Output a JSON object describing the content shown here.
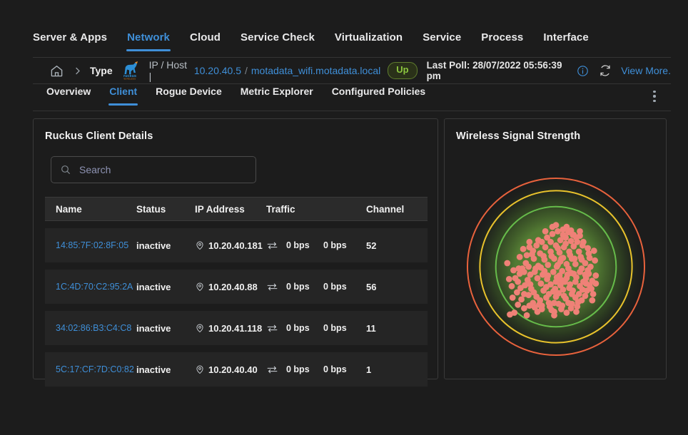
{
  "topnav": {
    "items": [
      {
        "label": "Server & Apps",
        "active": false
      },
      {
        "label": "Network",
        "active": true
      },
      {
        "label": "Cloud",
        "active": false
      },
      {
        "label": "Service Check",
        "active": false
      },
      {
        "label": "Virtualization",
        "active": false
      },
      {
        "label": "Service",
        "active": false
      },
      {
        "label": "Process",
        "active": false
      },
      {
        "label": "Interface",
        "active": false
      }
    ]
  },
  "breadcrumb": {
    "home_icon": "home-icon",
    "chevron_icon": "chevron-right-icon",
    "type_label": "Type",
    "vendor_logo": "ruckus-wireless-logo",
    "ip_host_label": "IP / Host |",
    "ip": "10.20.40.5",
    "separator": "/",
    "hostname": "motadata_wifi.motadata.local",
    "status": "Up",
    "last_poll_label": "Last Poll:",
    "last_poll_value": "28/07/2022 05:56:39 pm",
    "info_icon": "info-circle-icon",
    "refresh_icon": "refresh-icon",
    "view_more": "View More."
  },
  "subtabs": {
    "items": [
      {
        "label": "Overview",
        "active": false
      },
      {
        "label": "Client",
        "active": true
      },
      {
        "label": "Rogue Device",
        "active": false
      },
      {
        "label": "Metric Explorer",
        "active": false
      },
      {
        "label": "Configured Policies",
        "active": false
      }
    ],
    "kebab_icon": "more-vertical-icon"
  },
  "clients_card": {
    "title": "Ruckus Client Details",
    "search": {
      "value": "",
      "placeholder": "Search",
      "icon": "search-icon"
    },
    "columns": [
      "Name",
      "Status",
      "IP Address",
      "Traffic",
      "Channel"
    ],
    "rows": [
      {
        "name": "14:85:7F:02:8F:05",
        "status": "inactive",
        "ip": "10.20.40.181",
        "traffic_in": "0 bps",
        "traffic_out": "0 bps",
        "channel": "52"
      },
      {
        "name": "1C:4D:70:C2:95:2A",
        "status": "inactive",
        "ip": "10.20.40.88",
        "traffic_in": "0 bps",
        "traffic_out": "0 bps",
        "channel": "56"
      },
      {
        "name": "34:02:86:B3:C4:C8",
        "status": "inactive",
        "ip": "10.20.41.118",
        "traffic_in": "0 bps",
        "traffic_out": "0 bps",
        "channel": "11"
      },
      {
        "name": "5C:17:CF:7D:C0:82",
        "status": "inactive",
        "ip": "10.20.40.40",
        "traffic_in": "0 bps",
        "traffic_out": "0 bps",
        "channel": "1"
      }
    ],
    "pin_icon": "location-pin-icon",
    "traffic_icon": "exchange-arrows-icon"
  },
  "signal_card": {
    "title": "Wireless Signal Strength"
  },
  "chart_data": {
    "type": "scatter",
    "title": "Wireless Signal Strength",
    "description": "Radial signal-strength plot: concentric rings denote signal quality bands (green = strong / inner, yellow = medium, red = weak / outer). Salmon dots are client samples, clustered inside the innermost green ring.",
    "rings": [
      {
        "name": "weak",
        "color": "#e8623c",
        "radius_ratio": 1.0
      },
      {
        "name": "medium",
        "color": "#e8c22c",
        "radius_ratio": 0.86
      },
      {
        "name": "strong",
        "color": "#66bb4a",
        "radius_ratio": 0.68
      }
    ],
    "point_color": "#ef8177",
    "point_count": 186,
    "glow_color": "#5c8a37",
    "background": "#1c1c1c",
    "points": [
      [
        0.02,
        -0.4
      ],
      [
        0.08,
        -0.42
      ],
      [
        -0.04,
        -0.37
      ],
      [
        0.14,
        -0.39
      ],
      [
        0.19,
        -0.36
      ],
      [
        0.11,
        -0.33
      ],
      [
        -0.1,
        -0.33
      ],
      [
        0.23,
        -0.33
      ],
      [
        0.27,
        -0.35
      ],
      [
        0.05,
        -0.3
      ],
      [
        0.17,
        -0.29
      ],
      [
        -0.16,
        -0.28
      ],
      [
        -0.22,
        -0.24
      ],
      [
        -0.3,
        -0.22
      ],
      [
        -0.37,
        -0.2
      ],
      [
        -0.26,
        -0.18
      ],
      [
        -0.12,
        -0.22
      ],
      [
        0.0,
        -0.24
      ],
      [
        0.09,
        -0.22
      ],
      [
        0.2,
        -0.23
      ],
      [
        0.3,
        -0.24
      ],
      [
        0.36,
        -0.21
      ],
      [
        0.26,
        -0.17
      ],
      [
        0.15,
        -0.17
      ],
      [
        0.04,
        -0.16
      ],
      [
        -0.06,
        -0.17
      ],
      [
        -0.18,
        -0.15
      ],
      [
        -0.33,
        -0.13
      ],
      [
        -0.41,
        -0.11
      ],
      [
        -0.25,
        -0.09
      ],
      [
        -0.13,
        -0.08
      ],
      [
        -0.02,
        -0.09
      ],
      [
        0.08,
        -0.1
      ],
      [
        0.18,
        -0.09
      ],
      [
        0.28,
        -0.11
      ],
      [
        0.38,
        -0.1
      ],
      [
        0.44,
        -0.07
      ],
      [
        0.33,
        -0.04
      ],
      [
        0.22,
        -0.03
      ],
      [
        0.12,
        -0.03
      ],
      [
        0.02,
        -0.02
      ],
      [
        -0.09,
        -0.02
      ],
      [
        -0.2,
        -0.01
      ],
      [
        -0.31,
        0.0
      ],
      [
        -0.42,
        0.02
      ],
      [
        -0.48,
        0.04
      ],
      [
        -0.36,
        0.06
      ],
      [
        -0.24,
        0.06
      ],
      [
        -0.13,
        0.05
      ],
      [
        -0.03,
        0.06
      ],
      [
        0.07,
        0.05
      ],
      [
        0.17,
        0.07
      ],
      [
        0.27,
        0.06
      ],
      [
        0.37,
        0.08
      ],
      [
        0.45,
        0.1
      ],
      [
        0.34,
        0.13
      ],
      [
        0.23,
        0.12
      ],
      [
        0.12,
        0.13
      ],
      [
        0.01,
        0.12
      ],
      [
        -0.1,
        0.14
      ],
      [
        -0.21,
        0.13
      ],
      [
        -0.32,
        0.15
      ],
      [
        -0.43,
        0.17
      ],
      [
        -0.29,
        0.2
      ],
      [
        -0.17,
        0.19
      ],
      [
        -0.06,
        0.2
      ],
      [
        0.05,
        0.21
      ],
      [
        0.16,
        0.2
      ],
      [
        0.27,
        0.22
      ],
      [
        0.38,
        0.21
      ],
      [
        0.3,
        0.26
      ],
      [
        0.19,
        0.27
      ],
      [
        0.08,
        0.26
      ],
      [
        -0.03,
        0.28
      ],
      [
        -0.14,
        0.27
      ],
      [
        -0.25,
        0.29
      ],
      [
        -0.36,
        0.31
      ],
      [
        -0.22,
        0.34
      ],
      [
        -0.11,
        0.35
      ],
      [
        0.0,
        0.34
      ],
      [
        0.11,
        0.36
      ],
      [
        0.22,
        0.35
      ],
      [
        0.33,
        0.33
      ],
      [
        0.25,
        0.4
      ],
      [
        0.14,
        0.41
      ],
      [
        0.03,
        0.42
      ],
      [
        -0.08,
        0.41
      ],
      [
        -0.19,
        0.43
      ],
      [
        -0.3,
        0.44
      ],
      [
        -0.16,
        0.48
      ],
      [
        -0.05,
        0.49
      ],
      [
        0.06,
        0.48
      ],
      [
        0.17,
        0.47
      ],
      [
        -0.47,
        0.52
      ],
      [
        -0.52,
        0.54
      ],
      [
        -0.33,
        0.55
      ],
      [
        -0.55,
        -0.04
      ],
      [
        -0.5,
        0.22
      ],
      [
        0.41,
        0.16
      ],
      [
        0.43,
        -0.18
      ],
      [
        0.12,
        -0.45
      ],
      [
        -0.02,
        0.55
      ],
      [
        0.06,
        -0.09
      ],
      [
        -0.05,
        -0.12
      ],
      [
        0.14,
        0.02
      ],
      [
        -0.15,
        0.09
      ],
      [
        0.21,
        -0.09
      ],
      [
        0.0,
        0.17
      ],
      [
        -0.08,
        0.31
      ],
      [
        0.18,
        0.31
      ],
      [
        0.29,
        0.02
      ],
      [
        -0.28,
        0.25
      ],
      [
        0.35,
        0.27
      ],
      [
        -0.39,
        0.37
      ],
      [
        0.02,
        -0.21
      ],
      [
        0.24,
        -0.28
      ],
      [
        -0.2,
        -0.3
      ],
      [
        0.31,
        0.17
      ],
      [
        -0.44,
        0.29
      ],
      [
        0.09,
        0.33
      ],
      [
        -0.12,
        -0.4
      ],
      [
        0.04,
        0.1
      ],
      [
        -0.26,
        0.41
      ],
      [
        0.2,
        0.08
      ],
      [
        -0.34,
        -0.04
      ],
      [
        0.39,
        0.0
      ],
      [
        0.1,
        0.17
      ],
      [
        -0.02,
        0.41
      ],
      [
        0.26,
        0.31
      ],
      [
        -0.06,
        -0.28
      ],
      [
        0.16,
        -0.13
      ],
      [
        -0.23,
        0.02
      ],
      [
        0.33,
        0.09
      ],
      [
        -0.41,
        0.08
      ],
      [
        0.07,
        0.44
      ],
      [
        -0.18,
        0.38
      ],
      [
        0.29,
        -0.08
      ],
      [
        -0.31,
        0.32
      ],
      [
        0.01,
        0.0
      ],
      [
        0.13,
        0.09
      ],
      [
        -0.09,
        0.1
      ],
      [
        0.22,
        0.17
      ],
      [
        -0.35,
        0.21
      ],
      [
        0.4,
        0.25
      ],
      [
        -0.14,
        -0.12
      ],
      [
        0.05,
        -0.06
      ],
      [
        0.18,
        0.42
      ],
      [
        -0.27,
        -0.14
      ],
      [
        0.36,
        0.04
      ],
      [
        -0.46,
        0.13
      ],
      [
        0.11,
        -0.26
      ],
      [
        -0.01,
        0.25
      ],
      [
        0.24,
        0.45
      ],
      [
        -0.38,
        0.02
      ],
      [
        0.31,
        -0.28
      ],
      [
        -0.07,
        0.45
      ],
      [
        0.15,
        0.24
      ],
      [
        -0.29,
        0.09
      ],
      [
        0.42,
        0.31
      ],
      [
        -0.17,
        0.01
      ],
      [
        0.03,
        0.3
      ],
      [
        -0.43,
        0.43
      ],
      [
        0.27,
        -0.4
      ],
      [
        -0.24,
        0.46
      ],
      [
        0.08,
        -0.36
      ],
      [
        0.37,
        -0.15
      ],
      [
        -0.11,
        0.23
      ],
      [
        0.2,
        -0.36
      ],
      [
        -0.04,
        -0.45
      ],
      [
        0.34,
        0.19
      ],
      [
        -0.49,
        0.35
      ],
      [
        0.12,
        0.52
      ],
      [
        -0.02,
        0.51
      ],
      [
        0.23,
        0.51
      ],
      [
        -0.21,
        0.51
      ],
      [
        0.45,
        0.19
      ],
      [
        -0.53,
        0.14
      ],
      [
        0.06,
        0.15
      ],
      [
        -0.16,
        0.44
      ],
      [
        0.29,
        0.38
      ],
      [
        -0.36,
        0.47
      ],
      [
        0.41,
        0.38
      ],
      [
        0.17,
        -0.41
      ],
      [
        -0.3,
        -0.28
      ],
      [
        0.0,
        -0.47
      ],
      [
        -0.4,
        0.24
      ]
    ]
  }
}
